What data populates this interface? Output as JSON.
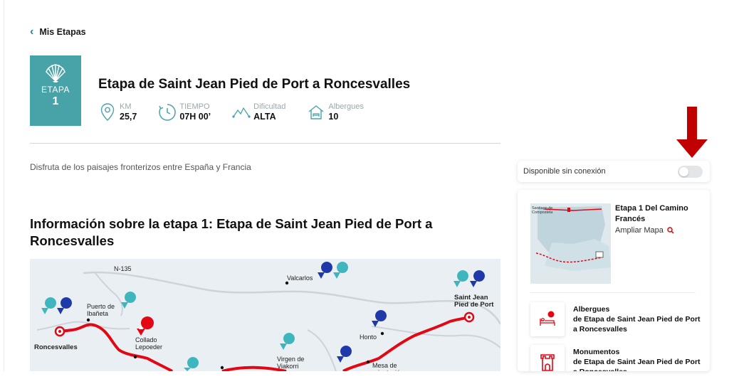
{
  "nav": {
    "back_label": "Mis Etapas"
  },
  "stage": {
    "badge_label": "ETAPA",
    "badge_number": "1",
    "title": "Etapa de Saint Jean Pied de Port a Roncesvalles",
    "stats": [
      {
        "label": "KM",
        "value": "25,7",
        "icon": "location-pin-icon"
      },
      {
        "label": "TIEMPO",
        "value": "07H 00’",
        "icon": "clock-icon"
      },
      {
        "label": "Dificultad",
        "value": "ALTA",
        "icon": "mountain-profile-icon"
      },
      {
        "label": "Albergues",
        "value": "10",
        "icon": "hostel-house-icon"
      }
    ],
    "description": "Disfruta de los paisajes fronterizos entre España y Francia",
    "info_title": "Información sobre la etapa 1: Etapa de Saint Jean Pied de Port a Roncesvalles"
  },
  "map": {
    "places": [
      {
        "name": "N-135"
      },
      {
        "name": "Valcarlos"
      },
      {
        "name": "Saint Jean Pied de Port"
      },
      {
        "name": "Puerto de Ibañeta"
      },
      {
        "name": "Roncesvalles"
      },
      {
        "name": "Collado Lepoeder"
      },
      {
        "name": "Virgen de Viakorri"
      },
      {
        "name": "Honto"
      },
      {
        "name": "Mesa de orientación"
      }
    ],
    "colors": {
      "route": "#e30613",
      "teal_pin": "#3fb6bd",
      "blue_pin": "#1f3aa8",
      "red_pin": "#e30613"
    }
  },
  "sidebar": {
    "offline_label": "Disponible sin conexión",
    "offline_enabled": false,
    "map_card": {
      "title": "Etapa 1 Del Camino Francés",
      "zoom_label": "Ampliar Mapa",
      "mini_map_label": "Santiago de Compostela"
    },
    "items": [
      {
        "title": "Albergues",
        "subtitle": "de Etapa de Saint Jean Pied de Port a Roncesvalles",
        "icon": "bed-icon"
      },
      {
        "title": "Monumentos",
        "subtitle": "de Etapa de Saint Jean Pied de Port a Roncesvalles",
        "icon": "castle-tower-icon"
      }
    ]
  },
  "colors": {
    "accent": "#48a3a8",
    "arrow": "#c00000",
    "brand_red": "#e30613"
  }
}
